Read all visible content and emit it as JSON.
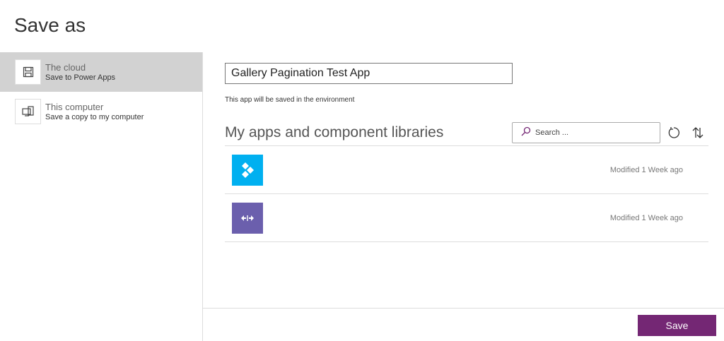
{
  "title": "Save as",
  "options": [
    {
      "label": "The cloud",
      "sublabel": "Save to Power Apps",
      "icon": "floppy-disk-icon",
      "selected": true
    },
    {
      "label": "This computer",
      "sublabel": "Save a copy to my computer",
      "icon": "computer-icon",
      "selected": false
    }
  ],
  "app_name": "Gallery Pagination Test App",
  "environment_note": "This app will be saved in the environment",
  "section_title": "My apps and component libraries",
  "search": {
    "placeholder": "Search ..."
  },
  "apps": [
    {
      "modified": "Modified 1 Week ago",
      "color": "#00b0f0",
      "icon": "diamonds-icon"
    },
    {
      "modified": "Modified 1 Week ago",
      "color": "#6b5fad",
      "icon": "split-arrows-icon"
    }
  ],
  "save_label": "Save"
}
